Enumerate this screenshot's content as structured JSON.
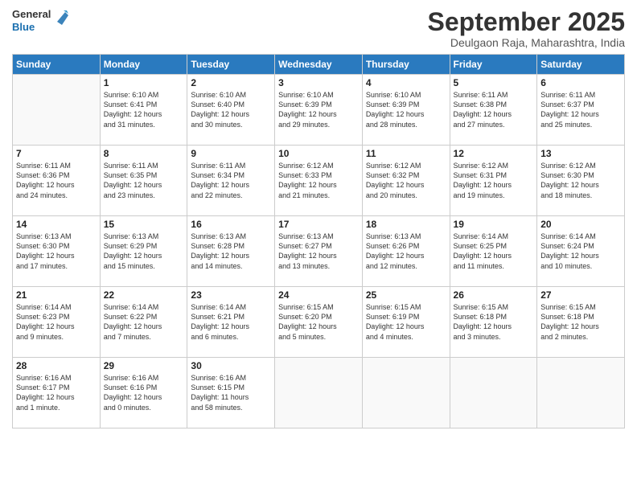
{
  "logo": {
    "line1": "General",
    "line2": "Blue"
  },
  "title": "September 2025",
  "location": "Deulgaon Raja, Maharashtra, India",
  "weekdays": [
    "Sunday",
    "Monday",
    "Tuesday",
    "Wednesday",
    "Thursday",
    "Friday",
    "Saturday"
  ],
  "weeks": [
    [
      {
        "day": "",
        "info": ""
      },
      {
        "day": "1",
        "info": "Sunrise: 6:10 AM\nSunset: 6:41 PM\nDaylight: 12 hours\nand 31 minutes."
      },
      {
        "day": "2",
        "info": "Sunrise: 6:10 AM\nSunset: 6:40 PM\nDaylight: 12 hours\nand 30 minutes."
      },
      {
        "day": "3",
        "info": "Sunrise: 6:10 AM\nSunset: 6:39 PM\nDaylight: 12 hours\nand 29 minutes."
      },
      {
        "day": "4",
        "info": "Sunrise: 6:10 AM\nSunset: 6:39 PM\nDaylight: 12 hours\nand 28 minutes."
      },
      {
        "day": "5",
        "info": "Sunrise: 6:11 AM\nSunset: 6:38 PM\nDaylight: 12 hours\nand 27 minutes."
      },
      {
        "day": "6",
        "info": "Sunrise: 6:11 AM\nSunset: 6:37 PM\nDaylight: 12 hours\nand 25 minutes."
      }
    ],
    [
      {
        "day": "7",
        "info": "Sunrise: 6:11 AM\nSunset: 6:36 PM\nDaylight: 12 hours\nand 24 minutes."
      },
      {
        "day": "8",
        "info": "Sunrise: 6:11 AM\nSunset: 6:35 PM\nDaylight: 12 hours\nand 23 minutes."
      },
      {
        "day": "9",
        "info": "Sunrise: 6:11 AM\nSunset: 6:34 PM\nDaylight: 12 hours\nand 22 minutes."
      },
      {
        "day": "10",
        "info": "Sunrise: 6:12 AM\nSunset: 6:33 PM\nDaylight: 12 hours\nand 21 minutes."
      },
      {
        "day": "11",
        "info": "Sunrise: 6:12 AM\nSunset: 6:32 PM\nDaylight: 12 hours\nand 20 minutes."
      },
      {
        "day": "12",
        "info": "Sunrise: 6:12 AM\nSunset: 6:31 PM\nDaylight: 12 hours\nand 19 minutes."
      },
      {
        "day": "13",
        "info": "Sunrise: 6:12 AM\nSunset: 6:30 PM\nDaylight: 12 hours\nand 18 minutes."
      }
    ],
    [
      {
        "day": "14",
        "info": "Sunrise: 6:13 AM\nSunset: 6:30 PM\nDaylight: 12 hours\nand 17 minutes."
      },
      {
        "day": "15",
        "info": "Sunrise: 6:13 AM\nSunset: 6:29 PM\nDaylight: 12 hours\nand 15 minutes."
      },
      {
        "day": "16",
        "info": "Sunrise: 6:13 AM\nSunset: 6:28 PM\nDaylight: 12 hours\nand 14 minutes."
      },
      {
        "day": "17",
        "info": "Sunrise: 6:13 AM\nSunset: 6:27 PM\nDaylight: 12 hours\nand 13 minutes."
      },
      {
        "day": "18",
        "info": "Sunrise: 6:13 AM\nSunset: 6:26 PM\nDaylight: 12 hours\nand 12 minutes."
      },
      {
        "day": "19",
        "info": "Sunrise: 6:14 AM\nSunset: 6:25 PM\nDaylight: 12 hours\nand 11 minutes."
      },
      {
        "day": "20",
        "info": "Sunrise: 6:14 AM\nSunset: 6:24 PM\nDaylight: 12 hours\nand 10 minutes."
      }
    ],
    [
      {
        "day": "21",
        "info": "Sunrise: 6:14 AM\nSunset: 6:23 PM\nDaylight: 12 hours\nand 9 minutes."
      },
      {
        "day": "22",
        "info": "Sunrise: 6:14 AM\nSunset: 6:22 PM\nDaylight: 12 hours\nand 7 minutes."
      },
      {
        "day": "23",
        "info": "Sunrise: 6:14 AM\nSunset: 6:21 PM\nDaylight: 12 hours\nand 6 minutes."
      },
      {
        "day": "24",
        "info": "Sunrise: 6:15 AM\nSunset: 6:20 PM\nDaylight: 12 hours\nand 5 minutes."
      },
      {
        "day": "25",
        "info": "Sunrise: 6:15 AM\nSunset: 6:19 PM\nDaylight: 12 hours\nand 4 minutes."
      },
      {
        "day": "26",
        "info": "Sunrise: 6:15 AM\nSunset: 6:18 PM\nDaylight: 12 hours\nand 3 minutes."
      },
      {
        "day": "27",
        "info": "Sunrise: 6:15 AM\nSunset: 6:18 PM\nDaylight: 12 hours\nand 2 minutes."
      }
    ],
    [
      {
        "day": "28",
        "info": "Sunrise: 6:16 AM\nSunset: 6:17 PM\nDaylight: 12 hours\nand 1 minute."
      },
      {
        "day": "29",
        "info": "Sunrise: 6:16 AM\nSunset: 6:16 PM\nDaylight: 12 hours\nand 0 minutes."
      },
      {
        "day": "30",
        "info": "Sunrise: 6:16 AM\nSunset: 6:15 PM\nDaylight: 11 hours\nand 58 minutes."
      },
      {
        "day": "",
        "info": ""
      },
      {
        "day": "",
        "info": ""
      },
      {
        "day": "",
        "info": ""
      },
      {
        "day": "",
        "info": ""
      }
    ]
  ]
}
